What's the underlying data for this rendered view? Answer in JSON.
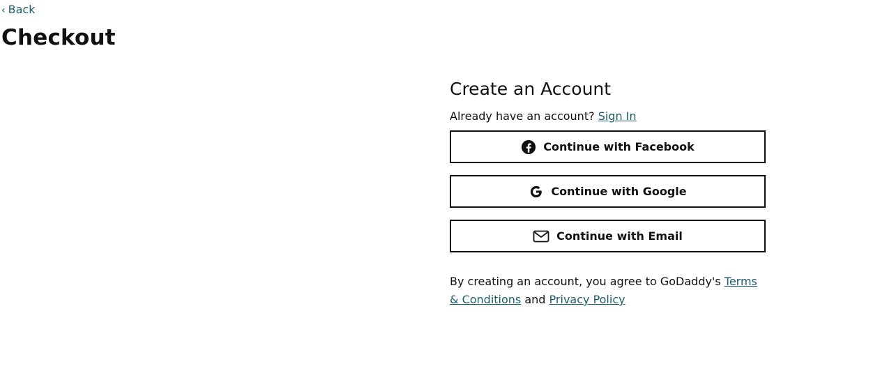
{
  "nav": {
    "back_label": "Back"
  },
  "page": {
    "title": "Checkout"
  },
  "account": {
    "heading": "Create an Account",
    "signin_prompt": "Already have an account?",
    "signin_link": "Sign In",
    "buttons": {
      "facebook": {
        "label": "Continue with Facebook",
        "icon": "facebook-icon"
      },
      "google": {
        "label": "Continue with Google",
        "icon": "google-icon"
      },
      "email": {
        "label": "Continue with Email",
        "icon": "mail-icon"
      }
    },
    "legal": {
      "prefix": "By creating an account, you agree to GoDaddy's",
      "terms_link": "Terms & Conditions",
      "conjunction": "and",
      "privacy_link": "Privacy Policy"
    }
  },
  "colors": {
    "link": "#1b5e6b",
    "text": "#111111",
    "border": "#111111",
    "background": "#ffffff"
  }
}
